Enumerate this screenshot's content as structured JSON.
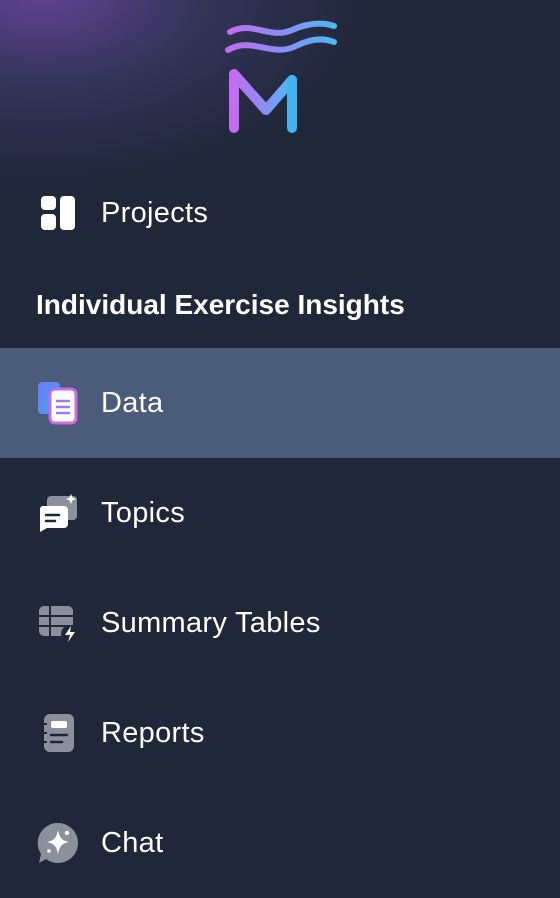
{
  "app": {
    "logo_icon": "m-wave-logo"
  },
  "nav": {
    "projects": {
      "label": "Projects",
      "icon": "grid-icon"
    },
    "section_title": "Individual Exercise Insights",
    "items": [
      {
        "id": "data",
        "label": "Data",
        "icon": "document-stack-icon",
        "active": true
      },
      {
        "id": "topics",
        "label": "Topics",
        "icon": "chat-sparkle-icon",
        "active": false
      },
      {
        "id": "summary_tables",
        "label": "Summary Tables",
        "icon": "table-bolt-icon",
        "active": false
      },
      {
        "id": "reports",
        "label": "Reports",
        "icon": "notebook-icon",
        "active": false
      },
      {
        "id": "chat",
        "label": "Chat",
        "icon": "sparkle-bubble-icon",
        "active": false
      }
    ]
  },
  "colors": {
    "background": "#1f2738",
    "active_background": "#4b5c7a",
    "icon_muted": "#9aa0ab",
    "text": "#ffffff"
  }
}
